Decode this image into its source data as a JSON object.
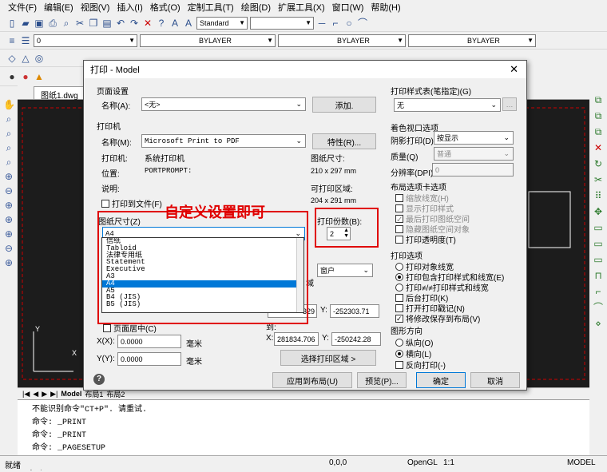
{
  "menu": [
    "文件(F)",
    "编辑(E)",
    "视图(V)",
    "插入(I)",
    "格式(O)",
    "定制工具(T)",
    "绘图(D)",
    "扩展工具(X)",
    "窗口(W)",
    "帮助(H)"
  ],
  "toolbar": {
    "style_combo": "Standard",
    "layer_value": "0",
    "linetype1": "BYLAYER",
    "linetype2": "BYLAYER",
    "linetype3": "BYLAYER"
  },
  "drawing_tab": "图纸1.dwg",
  "dialog": {
    "title": "打印 - Model",
    "page_setup": {
      "group": "页面设置",
      "name_label": "名称(A):",
      "name_value": "<无>",
      "add_button": "添加."
    },
    "printer": {
      "group": "打印机",
      "name_label": "名称(M):",
      "name_value": "Microsoft Print to PDF",
      "props_button": "特性(R)...",
      "plotter_label": "打印机:",
      "plotter_value": "系统打印机",
      "where_label": "位置:",
      "where_value": "PORTPROMPT:",
      "desc_label": "说明:",
      "paper_size_label": "图纸尺寸:",
      "paper_size_value": "210 x 297 mm",
      "printable_label": "可打印区域:",
      "printable_value": "204 x 291 mm",
      "print_to_file": "打印到文件(F)"
    },
    "paper_size": {
      "group": "图纸尺寸(Z)",
      "value": "A4",
      "options": [
        "信纸",
        "Tabloid",
        "法律专用纸",
        "Statement",
        "Executive",
        "A3",
        "A4",
        "A5",
        "B4 (JIS)",
        "B5 (JIS)"
      ],
      "selected_index": 6
    },
    "copies": {
      "label": "打印份数(B):",
      "value": "2"
    },
    "annotation_text": "自定义设置即可",
    "plot_area": {
      "window_combo": "窗户",
      "hidden": "域"
    },
    "offset": {
      "center": "页面居中(C)",
      "x_label": "X(X):",
      "x_value": "0.0000",
      "x_unit": "毫米",
      "y_label": "Y(Y):",
      "y_value": "0.0000",
      "y_unit": "毫米"
    },
    "window": {
      "from_x": "329",
      "from_y_label": "Y:",
      "from_y_value": "-252303.71",
      "to_label": "到:",
      "to_x_label": "X:",
      "to_x_value": "281834.706",
      "to_y_label": "Y:",
      "to_y_value": "-250242.28",
      "select_button": "选择打印区域 >"
    },
    "style_table": {
      "group": "打印样式表(笔指定)(G)",
      "value": "无"
    },
    "shaded": {
      "group": "着色视口选项",
      "shade_label": "阴影打印(D)",
      "shade_value": "按显示",
      "quality_label": "质量(Q)",
      "quality_value": "普通",
      "dpi_label": "分辨率(DPI)",
      "dpi_value": "0"
    },
    "layout_opts": {
      "group": "布局选项卡选项",
      "items": [
        "缩放线宽(H)",
        "显示打印样式",
        "最后打印图纸空间",
        "隐藏图纸空间对象",
        "打印透明度(T)"
      ]
    },
    "plot_opts": {
      "group": "打印选项",
      "items": [
        "打印对象线宽",
        "打印包含打印样式和线宽(E)",
        "打印≠/≠打印样式和线宽",
        "后台打印(K)",
        "打开打印戳记(N)",
        "将修改保存到布局(V)"
      ]
    },
    "orientation": {
      "group": "图形方向",
      "items": [
        "纵向(O)",
        "横向(L)",
        "反向打印(-)"
      ]
    },
    "buttons": {
      "apply": "应用到布局(U)",
      "preview": "预览(P)...",
      "ok": "确定",
      "cancel": "取消"
    }
  },
  "command": {
    "lines": [
      "不能识别命令\"CT+P\". 请重试.",
      "命令: _PRINT",
      "命令: _PRINT",
      "命令: _PAGESETUP"
    ],
    "prompt": "命令:",
    "current": "_PRINT"
  },
  "status": {
    "left": "就绪",
    "coords": "0,0,0",
    "gl": "OpenGL",
    "scale": "1:1",
    "model": "MODEL"
  },
  "layout_tabs": [
    "Model",
    "布局1",
    "布局2"
  ]
}
